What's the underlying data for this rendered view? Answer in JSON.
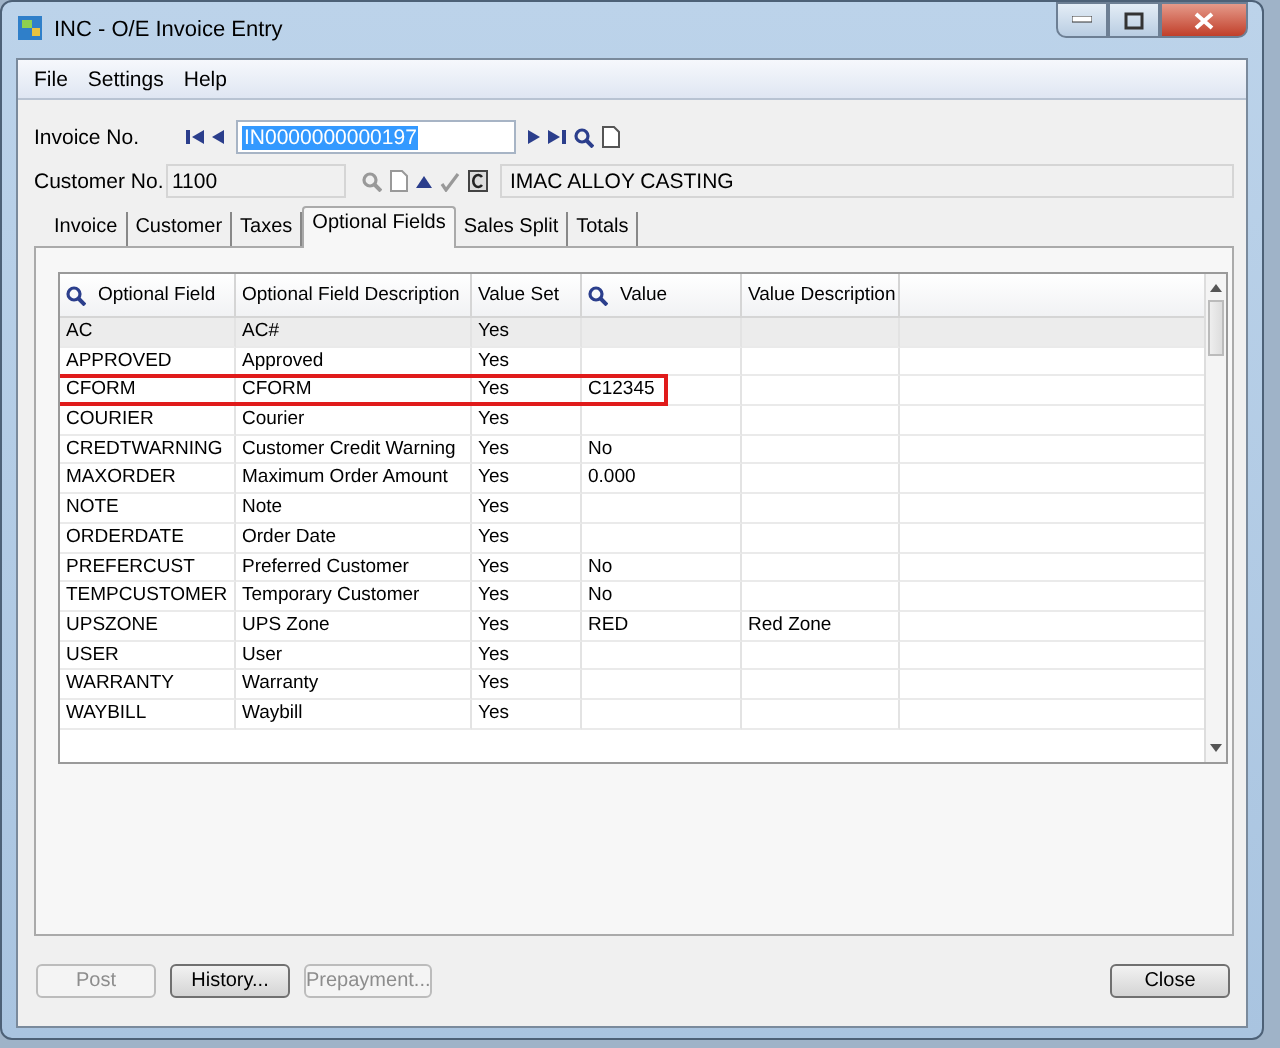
{
  "window": {
    "title": "INC - O/E Invoice Entry"
  },
  "menu": [
    "File",
    "Settings",
    "Help"
  ],
  "invoice": {
    "label": "Invoice No.",
    "value": "IN0000000000197",
    "selected": true
  },
  "customer": {
    "label": "Customer No.",
    "value": "1100",
    "name": "IMAC ALLOY CASTING"
  },
  "tabs": [
    {
      "label": "Invoice",
      "selected": false
    },
    {
      "label": "Customer",
      "selected": false
    },
    {
      "label": "Taxes",
      "selected": false
    },
    {
      "label": "Optional Fields",
      "selected": true
    },
    {
      "label": "Sales Split",
      "selected": false
    },
    {
      "label": "Totals",
      "selected": false
    }
  ],
  "grid": {
    "columns": [
      {
        "label": "Optional Field",
        "search": true
      },
      {
        "label": "Optional Field Description",
        "search": false
      },
      {
        "label": "Value Set",
        "search": false
      },
      {
        "label": "Value",
        "search": true
      },
      {
        "label": "Value Description",
        "search": false
      }
    ],
    "rows": [
      {
        "optional_field": "AC",
        "description": "AC#",
        "value_set": "Yes",
        "selected": true,
        "outlined": false
      },
      {
        "optional_field": "APPROVED",
        "description": "Approved",
        "value_set": "Yes",
        "selected": false,
        "outlined": false
      },
      {
        "optional_field": "CFORM",
        "description": "CFORM",
        "value_set": "Yes",
        "value": "C12345",
        "selected": false,
        "outlined": true
      },
      {
        "optional_field": "COURIER",
        "description": "Courier",
        "value_set": "Yes",
        "selected": false,
        "outlined": false
      },
      {
        "optional_field": "CREDTWARNING",
        "description": "Customer Credit Warning",
        "value_set": "Yes",
        "value": "No",
        "selected": false,
        "outlined": false
      },
      {
        "optional_field": "MAXORDER",
        "description": "Maximum Order Amount",
        "value_set": "Yes",
        "value": "0.000",
        "selected": false,
        "outlined": false
      },
      {
        "optional_field": "NOTE",
        "description": "Note",
        "value_set": "Yes",
        "selected": false,
        "outlined": false
      },
      {
        "optional_field": "ORDERDATE",
        "description": "Order Date",
        "value_set": "Yes",
        "selected": false,
        "outlined": false
      },
      {
        "optional_field": "PREFERCUST",
        "description": "Preferred Customer",
        "value_set": "Yes",
        "value": "No",
        "selected": false,
        "outlined": false
      },
      {
        "optional_field": "TEMPCUSTOMER",
        "description": "Temporary Customer",
        "value_set": "Yes",
        "value": "No",
        "selected": false,
        "outlined": false
      },
      {
        "optional_field": "UPSZONE",
        "description": "UPS Zone",
        "value_set": "Yes",
        "value": "RED",
        "value_description": "Red Zone",
        "selected": false,
        "outlined": false
      },
      {
        "optional_field": "USER",
        "description": "User",
        "value_set": "Yes",
        "selected": false,
        "outlined": false
      },
      {
        "optional_field": "WARRANTY",
        "description": "Warranty",
        "value_set": "Yes",
        "selected": false,
        "outlined": false
      },
      {
        "optional_field": "WAYBILL",
        "description": "Waybill",
        "value_set": "Yes",
        "selected": false,
        "outlined": false
      }
    ]
  },
  "buttons": [
    {
      "label": "Post",
      "disabled": true
    },
    {
      "label": "History...",
      "disabled": false
    },
    {
      "label": "Prepayment...",
      "disabled": true
    }
  ],
  "close_button": {
    "label": "Close",
    "disabled": false
  }
}
